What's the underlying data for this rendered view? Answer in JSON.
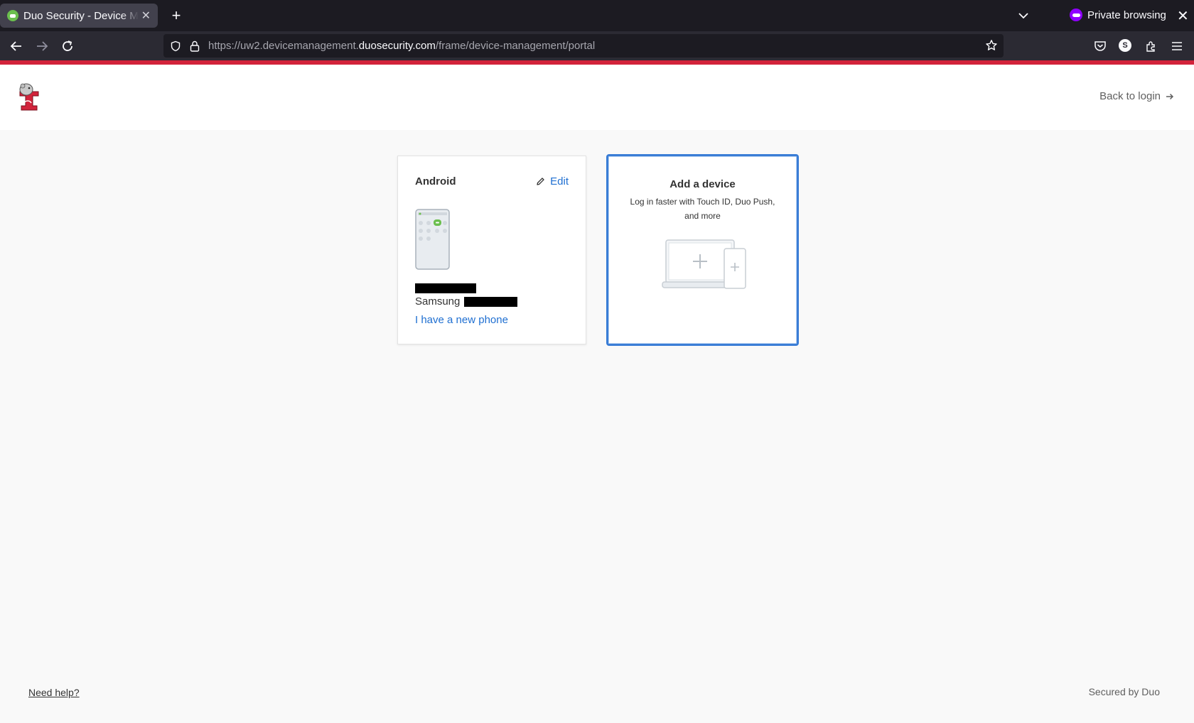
{
  "browser": {
    "tab_title": "Duo Security - Device Management",
    "private_label": "Private browsing",
    "url": {
      "prefix": "https://uw2.devicemanagement.",
      "host": "duosecurity.com",
      "path": "/frame/device-management/portal"
    },
    "icons": [
      "back-icon",
      "forward-icon",
      "reload-icon",
      "shield-icon",
      "lock-icon",
      "star-icon",
      "pocket-icon",
      "account-icon",
      "extensions-icon",
      "menu-icon"
    ],
    "account_initial": "S"
  },
  "colors": {
    "brand_red": "#d2233b",
    "link_blue": "#1f6fd1",
    "focus_blue": "#3a7dd6"
  },
  "header": {
    "back_to_login": "Back to login"
  },
  "devices": [
    {
      "name": "Android",
      "edit_label": "Edit",
      "model_prefix": "Samsung",
      "new_phone_link": "I have a new phone"
    }
  ],
  "add_device": {
    "title": "Add a device",
    "description": "Log in faster with Touch ID, Duo Push, and more"
  },
  "footer": {
    "need_help": "Need help?",
    "secured_by": "Secured by Duo"
  }
}
